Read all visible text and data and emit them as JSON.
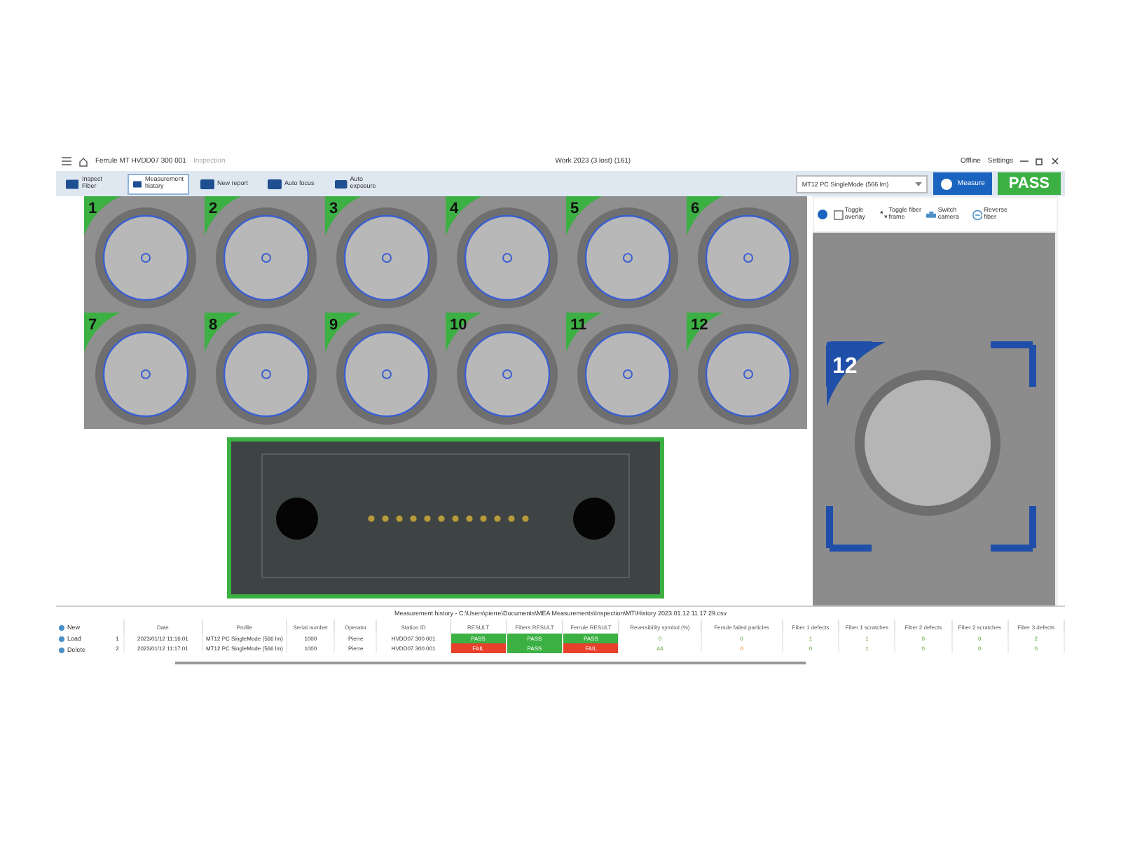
{
  "title_bar": {
    "path": "Ferrule MT HVDD07 300 001",
    "breadcrumb": "Inspection",
    "title": "Work 2023 (3 lost) (161)",
    "offline": "Offline",
    "settings": "Settings"
  },
  "toolbar": {
    "items": [
      {
        "label": "Inspect Fiber",
        "selected": false
      },
      {
        "label": "Measurement history",
        "selected": true
      },
      {
        "label": "New report",
        "selected": false
      },
      {
        "label": "Auto focus",
        "selected": false
      },
      {
        "label": "Auto exposure",
        "selected": false
      }
    ],
    "profile": "MT12 PC SingleMode (566 lm)",
    "measure": "Measure",
    "result": {
      "label": "PASS",
      "passed": true
    }
  },
  "fibers": [
    {
      "label": "1",
      "passed": true
    },
    {
      "label": "2",
      "passed": true
    },
    {
      "label": "3",
      "passed": true
    },
    {
      "label": "4",
      "passed": true
    },
    {
      "label": "5",
      "passed": true
    },
    {
      "label": "6",
      "passed": true
    },
    {
      "label": "7",
      "passed": true
    },
    {
      "label": "8",
      "passed": true
    },
    {
      "label": "9",
      "passed": true
    },
    {
      "label": "10",
      "passed": true
    },
    {
      "label": "11",
      "passed": true
    },
    {
      "label": "12",
      "passed": true
    }
  ],
  "inspector": {
    "tools": [
      {
        "label": "Toggle overlay",
        "kind": "check"
      },
      {
        "label": "Toggle fiber frame",
        "kind": "arrows"
      },
      {
        "label": "Switch camera",
        "kind": "camera"
      },
      {
        "label": "Reverse fiber",
        "kind": "reverse"
      }
    ],
    "fiber_label": "12"
  },
  "history": {
    "title": "Measurement history - C:\\Users\\pierre\\Documents\\MEA Measurements\\Inspection\\MT\\History 2023.01.12 11 17 29.csv",
    "actions": [
      "New",
      "Load",
      "Delete"
    ],
    "columns": [
      "Date",
      "Profile",
      "Serial number",
      "Operator",
      "Station ID",
      "RESULT",
      "Fibers RESULT",
      "Ferrule RESULT",
      "Reversibility symbol (%)",
      "Ferrule failed particles",
      "Fiber 1 defects",
      "Fiber 1 scratches",
      "Fiber 2 defects",
      "Fiber 2 scratches",
      "Fiber 3 defects"
    ],
    "rows": [
      {
        "index": "1",
        "cells": [
          {
            "text": "2023/01/12 11:16:01",
            "kind": "text"
          },
          {
            "text": "MT12 PC SingleMode (566 lm)",
            "kind": "text"
          },
          {
            "text": "1000",
            "kind": "text"
          },
          {
            "text": "Pierre",
            "kind": "text"
          },
          {
            "text": "HVDD07 300 001",
            "kind": "text"
          },
          {
            "text": "PASS",
            "kind": "badge",
            "passed": true
          },
          {
            "text": "PASS",
            "kind": "badge",
            "passed": true
          },
          {
            "text": "PASS",
            "kind": "badge",
            "passed": true
          },
          {
            "text": "0",
            "kind": "value",
            "passed": true
          },
          {
            "text": "0",
            "kind": "value",
            "passed": true
          },
          {
            "text": "1",
            "kind": "value",
            "passed": true
          },
          {
            "text": "1",
            "kind": "value",
            "passed": true
          },
          {
            "text": "0",
            "kind": "value",
            "passed": true
          },
          {
            "text": "0",
            "kind": "value",
            "passed": true
          },
          {
            "text": "2",
            "kind": "value",
            "passed": true
          }
        ]
      },
      {
        "index": "2",
        "cells": [
          {
            "text": "2023/01/12 11:17:01",
            "kind": "text"
          },
          {
            "text": "MT12 PC SingleMode (566 lm)",
            "kind": "text"
          },
          {
            "text": "1000",
            "kind": "text"
          },
          {
            "text": "Pierre",
            "kind": "text"
          },
          {
            "text": "HVDD07 300 001",
            "kind": "text"
          },
          {
            "text": "FAIL",
            "kind": "badge",
            "passed": false
          },
          {
            "text": "PASS",
            "kind": "badge",
            "passed": true
          },
          {
            "text": "FAIL",
            "kind": "badge",
            "passed": false
          },
          {
            "text": "44",
            "kind": "value",
            "passed": true
          },
          {
            "text": "0",
            "kind": "value",
            "passed": false
          },
          {
            "text": "0",
            "kind": "value",
            "passed": true
          },
          {
            "text": "1",
            "kind": "value",
            "passed": true
          },
          {
            "text": "0",
            "kind": "value",
            "passed": true
          },
          {
            "text": "0",
            "kind": "value",
            "passed": true
          },
          {
            "text": "0",
            "kind": "value",
            "passed": true
          }
        ]
      }
    ]
  }
}
